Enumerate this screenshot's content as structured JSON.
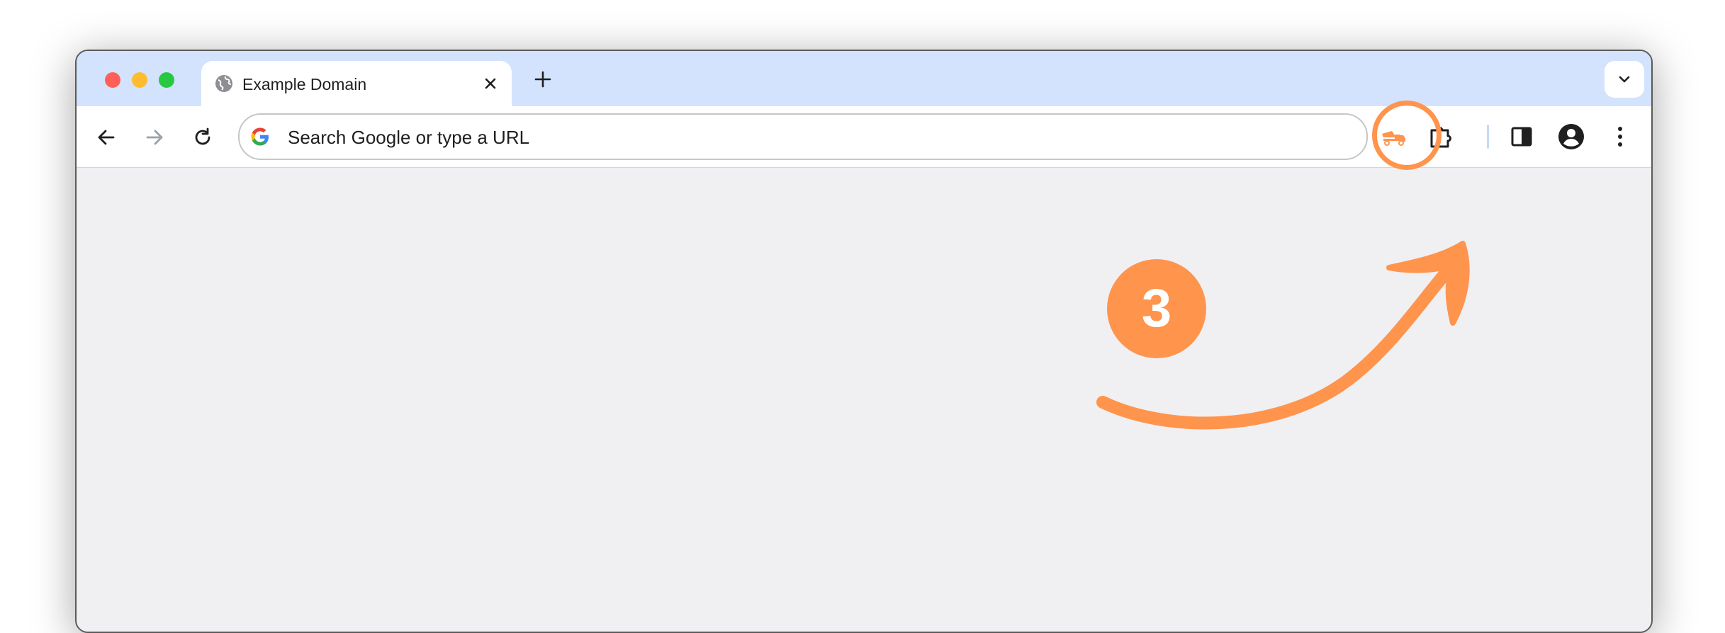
{
  "tabs": [
    {
      "title": "Example Domain",
      "favicon": "globe-icon",
      "active": true
    }
  ],
  "omnibox": {
    "placeholder": "Search Google or type a URL"
  },
  "toolbar": {
    "extension_icon": "cement-truck-icon",
    "buttons": [
      "back-icon",
      "forward-icon",
      "reload-icon",
      "extensions-puzzle-icon",
      "side-panel-icon",
      "profile-avatar-icon",
      "menu-kebab-icon"
    ]
  },
  "annotation": {
    "step_number": "3"
  },
  "colors": {
    "accent": "#ff944d",
    "titlebar": "#d3e3fd",
    "content_bg": "#f0f0f3",
    "traffic_red": "#ff5f57",
    "traffic_yellow": "#febc2e",
    "traffic_green": "#28c840"
  }
}
